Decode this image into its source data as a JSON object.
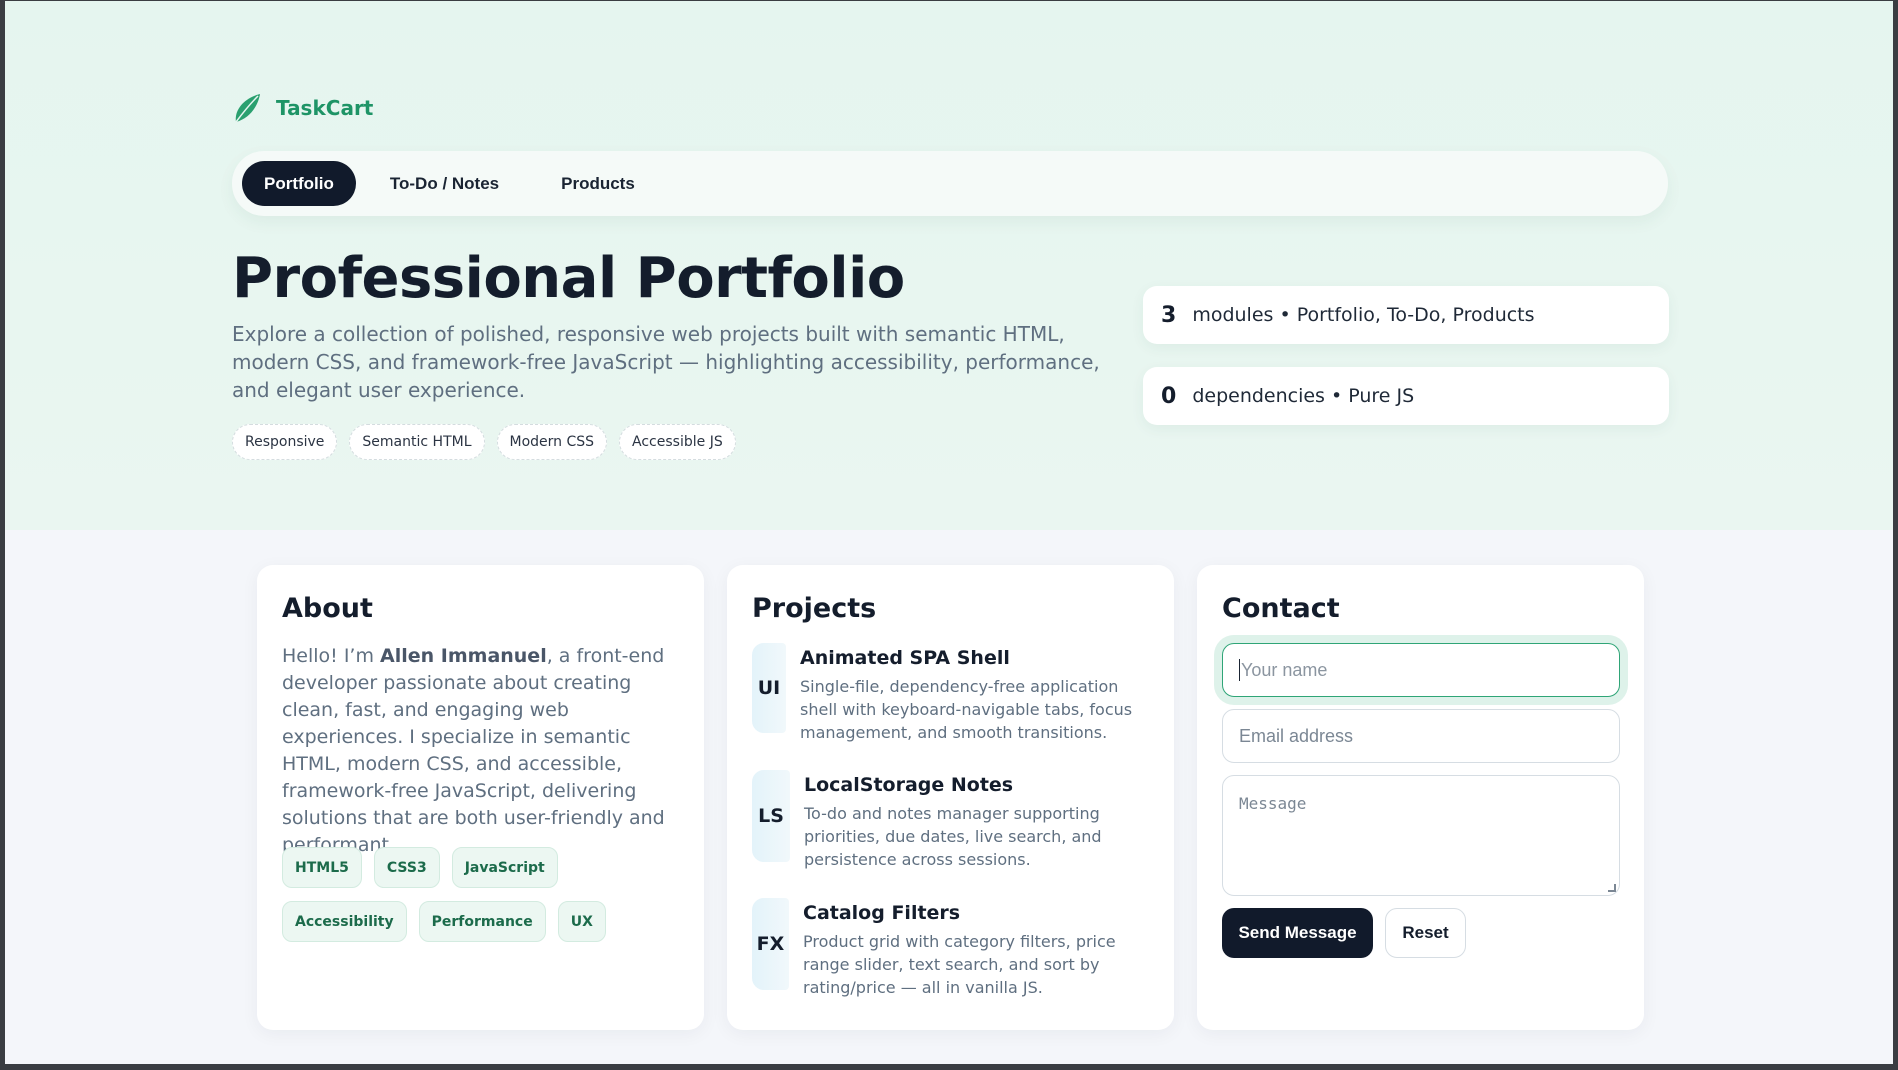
{
  "brand": {
    "name": "TaskCart",
    "logo_icon": "leaf-icon",
    "color": "#1e9466"
  },
  "nav": {
    "items": [
      {
        "label": "Portfolio",
        "active": true
      },
      {
        "label": "To-Do / Notes",
        "active": false
      },
      {
        "label": "Products",
        "active": false
      }
    ]
  },
  "hero": {
    "title": "Professional Portfolio",
    "description": "Explore a collection of polished, responsive web projects built with semantic HTML, modern CSS, and framework-free JavaScript — highlighting accessibility, performance, and elegant user experience.",
    "tags": [
      "Responsive",
      "Semantic HTML",
      "Modern CSS",
      "Accessible JS"
    ]
  },
  "stats": [
    {
      "value": "3",
      "text": "modules • Portfolio, To-Do, Products"
    },
    {
      "value": "0",
      "text": "dependencies • Pure JS"
    }
  ],
  "about": {
    "heading": "About",
    "text_before": "Hello! I’m ",
    "name": "Allen Immanuel",
    "text_after": ", a front-end developer passionate about creating clean, fast, and engaging web experiences. I specialize in semantic HTML, modern CSS, and accessible, framework-free JavaScript, delivering solutions that are both user-friendly and performant.",
    "skills": [
      "HTML5",
      "CSS3",
      "JavaScript",
      "Accessibility",
      "Performance",
      "UX"
    ]
  },
  "projects": {
    "heading": "Projects",
    "items": [
      {
        "badge": "UI",
        "title": "Animated SPA Shell",
        "description": "Single-file, dependency-free application shell with keyboard-navigable tabs, focus management, and smooth transitions."
      },
      {
        "badge": "LS",
        "title": "LocalStorage Notes",
        "description": "To-do and notes manager supporting priorities, due dates, live search, and persistence across sessions."
      },
      {
        "badge": "FX",
        "title": "Catalog Filters",
        "description": "Product grid with category filters, price range slider, text search, and sort by rating/price — all in vanilla JS."
      }
    ]
  },
  "contact": {
    "heading": "Contact",
    "name_placeholder": "Your name",
    "email_placeholder": "Email address",
    "message_placeholder": "Message",
    "send_label": "Send Message",
    "reset_label": "Reset"
  },
  "colors": {
    "accent": "#1e9466",
    "dark": "#111a2b",
    "hero_bg": "#e5f5ef"
  }
}
